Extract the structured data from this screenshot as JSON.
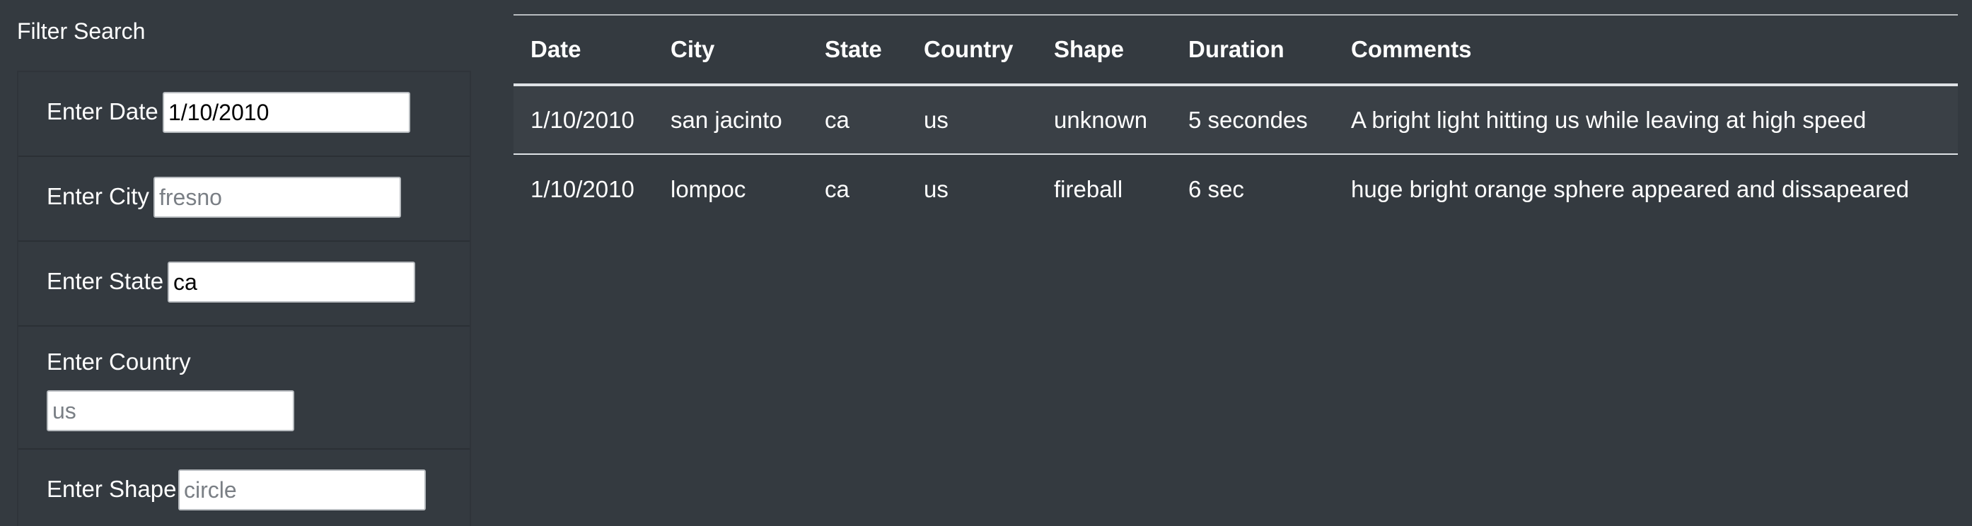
{
  "filter": {
    "title": "Filter Search",
    "fields": [
      {
        "label": "Enter Date",
        "value": "1/10/2010",
        "placeholder": ""
      },
      {
        "label": "Enter City",
        "value": "",
        "placeholder": "fresno"
      },
      {
        "label": "Enter State",
        "value": "ca",
        "placeholder": ""
      },
      {
        "label": "Enter Country",
        "value": "",
        "placeholder": "us"
      },
      {
        "label": "Enter Shape",
        "value": "",
        "placeholder": "circle"
      }
    ]
  },
  "table": {
    "columns": [
      "Date",
      "City",
      "State",
      "Country",
      "Shape",
      "Duration",
      "Comments"
    ],
    "rows": [
      [
        "1/10/2010",
        "san jacinto",
        "ca",
        "us",
        "unknown",
        "5 secondes",
        "A bright light hitting us while leaving at high speed"
      ],
      [
        "1/10/2010",
        "lompoc",
        "ca",
        "us",
        "fireball",
        "6 sec",
        "huge bright orange sphere appeared and dissapeared"
      ]
    ]
  },
  "colors": {
    "background": "#343a40",
    "text": "#ffffff",
    "input_background": "#ffffff"
  }
}
